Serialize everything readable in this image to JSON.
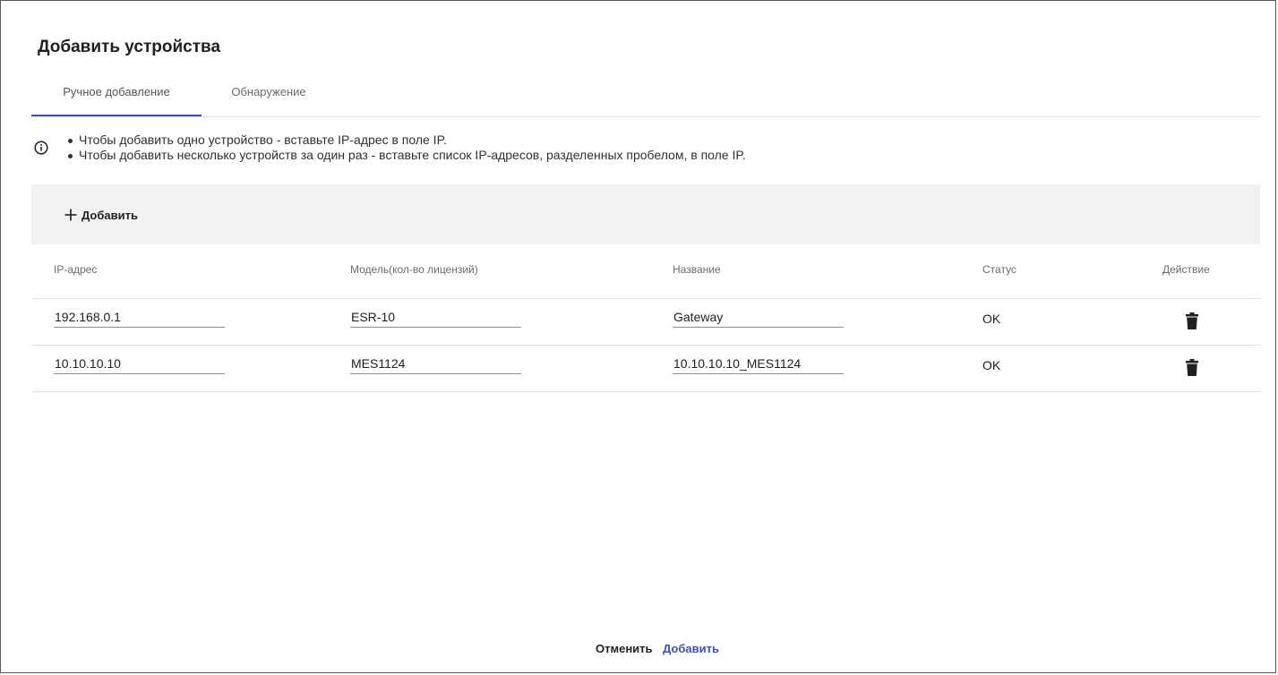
{
  "dialog": {
    "title": "Добавить устройства"
  },
  "tabs": [
    {
      "label": "Ручное добавление",
      "active": true
    },
    {
      "label": "Обнаружение",
      "active": false
    }
  ],
  "info": {
    "icon": "info-circle-icon",
    "lines": [
      "Чтобы добавить одно устройство - вставьте IP-адрес в поле IP.",
      "Чтобы добавить несколько устройств за один раз - вставьте список IP-адресов, разделенных пробелом, в поле IP."
    ]
  },
  "toolbar": {
    "add_label": "Добавить",
    "add_icon": "plus-icon"
  },
  "table": {
    "columns": [
      "IP-адрес",
      "Модель(кол-во лицензий)",
      "Название",
      "Статус",
      "Действие"
    ],
    "rows": [
      {
        "ip": "192.168.0.1",
        "model": "ESR-10",
        "name": "Gateway",
        "status": "OK",
        "action_icon": "trash-icon"
      },
      {
        "ip": "10.10.10.10",
        "model": "MES1124",
        "name": "10.10.10.10_MES1124",
        "status": "OK",
        "action_icon": "trash-icon"
      }
    ]
  },
  "footer": {
    "cancel_label": "Отменить",
    "submit_label": "Добавить"
  },
  "colors": {
    "accent": "#3f51b5",
    "toolbar_bg": "#f2f2f2"
  }
}
